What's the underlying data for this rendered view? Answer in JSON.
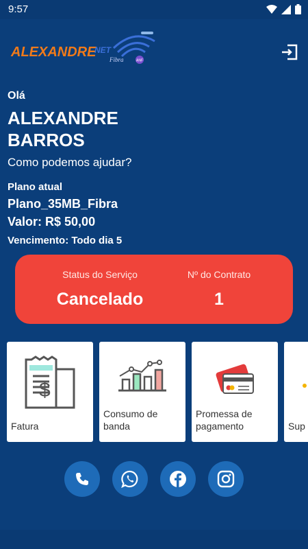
{
  "status_bar": {
    "time": "9:57"
  },
  "header": {
    "logo_text_main": "ALEXANDRE",
    "logo_text_net": "NET",
    "logo_text_fibra": "Fibra",
    "logo_badge": "ANF"
  },
  "greeting": {
    "hello": "Olá",
    "name": "ALEXANDRE BARROS",
    "question": "Como podemos ajudar?"
  },
  "plan": {
    "label": "Plano atual",
    "name": "Plano_35MB_Fibra",
    "value": "Valor: R$ 50,00",
    "due": "Vencimento: Todo dia 5"
  },
  "service_status": {
    "status_label": "Status do Serviço",
    "status_value": "Cancelado",
    "contract_label": "Nº do Contrato",
    "contract_value": "1",
    "color": "#f0443a"
  },
  "tiles": [
    {
      "label": "Fatura",
      "icon": "invoice-icon"
    },
    {
      "label_line1": "Consumo de",
      "label_line2": "banda",
      "icon": "bar-chart-icon"
    },
    {
      "label_line1": "Promessa de",
      "label_line2": "pagamento",
      "icon": "credit-card-icon"
    },
    {
      "label": "Sup",
      "icon": "support-icon"
    }
  ],
  "social": [
    {
      "name": "phone",
      "icon": "phone-icon"
    },
    {
      "name": "whatsapp",
      "icon": "whatsapp-icon"
    },
    {
      "name": "facebook",
      "icon": "facebook-icon"
    },
    {
      "name": "instagram",
      "icon": "instagram-icon"
    }
  ],
  "colors": {
    "background": "#0b3e7a",
    "accent": "#1e6bb8",
    "logo_orange": "#f07a1a"
  }
}
